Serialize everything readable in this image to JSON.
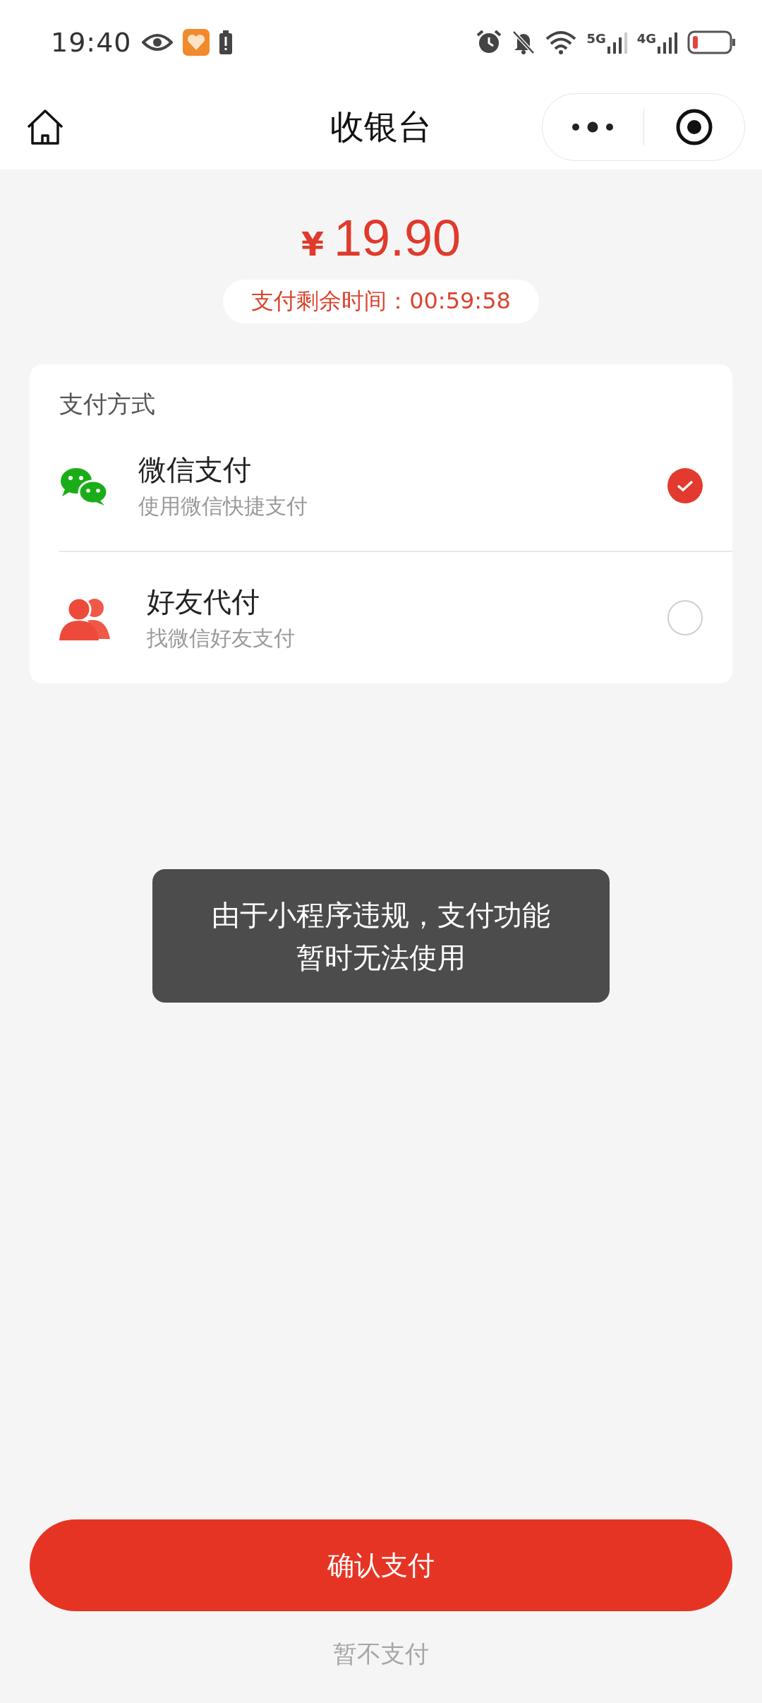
{
  "status_bar": {
    "time": "19:40",
    "networks": [
      "5G",
      "4G"
    ]
  },
  "header": {
    "title": "收银台"
  },
  "amount": {
    "currency": "¥",
    "value": "19.90"
  },
  "countdown": "支付剩余时间：00:59:58",
  "payment": {
    "title": "支付方式",
    "methods": [
      {
        "kind": "wechat",
        "name": "微信支付",
        "description": "使用微信快捷支付",
        "selected": true
      },
      {
        "kind": "friend",
        "name": "好友代付",
        "description": "找微信好友支付",
        "selected": false
      }
    ]
  },
  "toast": {
    "lines": [
      "由于小程序违规，支付功能",
      "暂时无法使用"
    ]
  },
  "actions": {
    "confirm": "确认支付",
    "cancel": "暂不支付"
  }
}
